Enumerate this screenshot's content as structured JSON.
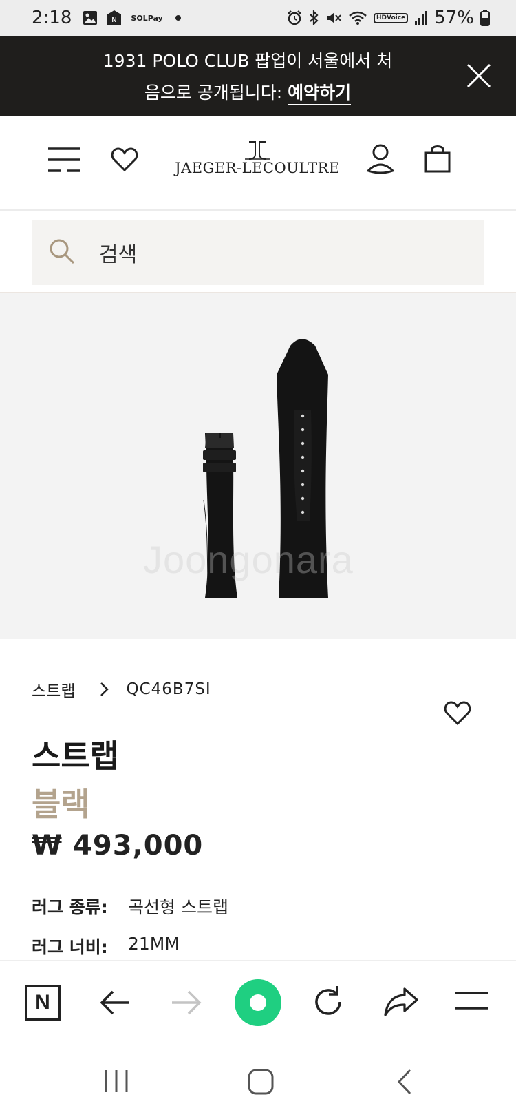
{
  "status_bar": {
    "time": "2:18",
    "left_icons": [
      "gallery-icon",
      "n-notification-icon",
      "sol-pay-icon",
      "dot-icon"
    ],
    "sol_pay_label_1": "SOL",
    "sol_pay_label_2": "Pay",
    "right_icons": [
      "alarm-icon",
      "bluetooth-icon",
      "mute-icon",
      "wifi-icon",
      "hd-voice-icon",
      "signal-icon",
      "battery-icon"
    ],
    "hd_label_1": "HD",
    "hd_label_2": "Voice",
    "battery": "57%"
  },
  "banner": {
    "text_line_1": "1931 POLO CLUB 팝업이 서울에서 처",
    "text_line_2": "음으로 공개됩니다:",
    "link": "예약하기",
    "close_icon": "close-icon"
  },
  "header": {
    "logo": "JAEGER-LECOULTRE",
    "icons": [
      "menu-icon",
      "heart-icon",
      "account-icon",
      "bag-icon"
    ]
  },
  "search": {
    "placeholder": "검색"
  },
  "product_image": {
    "watermark": "Joongonara"
  },
  "product": {
    "breadcrumb_parent": "스트랩",
    "breadcrumb_current": "QC46B7SI",
    "title": "스트랩",
    "color": "블랙",
    "price": "₩ 493,000",
    "specs": [
      {
        "label": "러그 종류:",
        "value": "곡선형 스트랩"
      },
      {
        "label": "러그 너비:",
        "value": "21MM"
      }
    ]
  },
  "browser_toolbar": {
    "n_label": "N",
    "buttons": [
      "naver-home-button",
      "back-button",
      "forward-button",
      "green-dot-button",
      "refresh-button",
      "share-button",
      "menu-button"
    ]
  },
  "colors": {
    "banner_bg": "#1f1e1c",
    "accent_gold": "#b3a38d",
    "green": "#1fcf81",
    "search_bg": "#f4f3f1"
  }
}
